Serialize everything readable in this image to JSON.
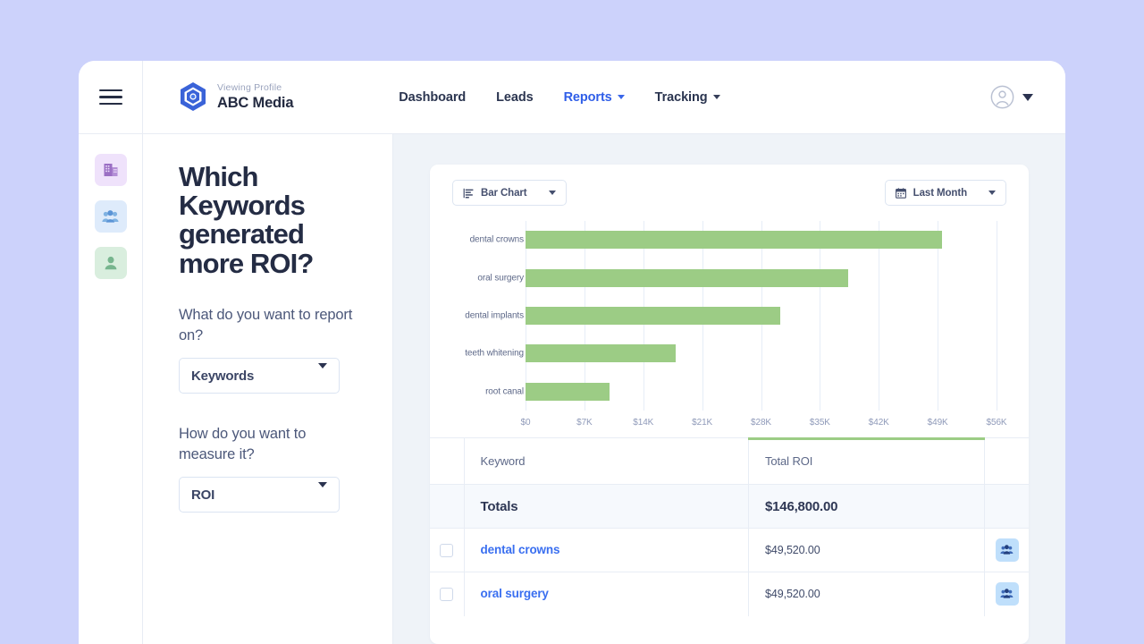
{
  "topbar": {
    "menu_icon": "hamburger-icon",
    "brand": {
      "kicker": "Viewing Profile",
      "name": "ABC Media",
      "logo_icon": "hexagon-logo-icon"
    },
    "nav": [
      {
        "label": "Dashboard",
        "active": false,
        "has_caret": false
      },
      {
        "label": "Leads",
        "active": false,
        "has_caret": false
      },
      {
        "label": "Reports",
        "active": true,
        "has_caret": true
      },
      {
        "label": "Tracking",
        "active": false,
        "has_caret": true
      }
    ],
    "account": {
      "avatar_icon": "user-circle-icon",
      "caret_icon": "caret-down-icon"
    }
  },
  "rail": {
    "items": [
      {
        "name": "company-icon",
        "label": "Company",
        "color": "#efe2fb"
      },
      {
        "name": "group-icon",
        "label": "Groups",
        "color": "#deebfb"
      },
      {
        "name": "person-icon",
        "label": "Person",
        "color": "#d9eede"
      }
    ]
  },
  "question_panel": {
    "title": "Which Keywords generated more ROI?",
    "fields": [
      {
        "label": "What do you want to report on?",
        "value": "Keywords"
      },
      {
        "label": "How do you want to measure it?",
        "value": "ROI"
      }
    ]
  },
  "card": {
    "chart_type_selector": {
      "label": "Bar Chart",
      "icon": "bar-chart-icon"
    },
    "date_selector": {
      "label": "Last Month",
      "icon": "calendar-icon"
    }
  },
  "chart_data": {
    "type": "bar",
    "orientation": "horizontal",
    "title": "",
    "xlabel": "",
    "ylabel": "",
    "categories": [
      "dental crowns",
      "oral surgery",
      "dental implants",
      "teeth whitening",
      "root canal"
    ],
    "values": [
      49520,
      38400,
      30300,
      17900,
      10000
    ],
    "tick_labels": [
      "$0",
      "$7K",
      "$14K",
      "$21K",
      "$28K",
      "$35K",
      "$42K",
      "$49K",
      "$56K"
    ],
    "tick_values": [
      0,
      7000,
      14000,
      21000,
      28000,
      35000,
      42000,
      49000,
      56000
    ],
    "xlim": [
      0,
      56000
    ],
    "bar_color": "#9ccc85",
    "grid": true,
    "legend": "none"
  },
  "table": {
    "columns": [
      "",
      "Keyword",
      "Total ROI",
      ""
    ],
    "totals_label": "Totals",
    "totals_value": "$146,800.00",
    "rows": [
      {
        "keyword": "dental crowns",
        "total_roi": "$49,520.00",
        "action_icon": "group-icon"
      },
      {
        "keyword": "oral surgery",
        "total_roi": "$49,520.00",
        "action_icon": "group-icon"
      }
    ]
  }
}
